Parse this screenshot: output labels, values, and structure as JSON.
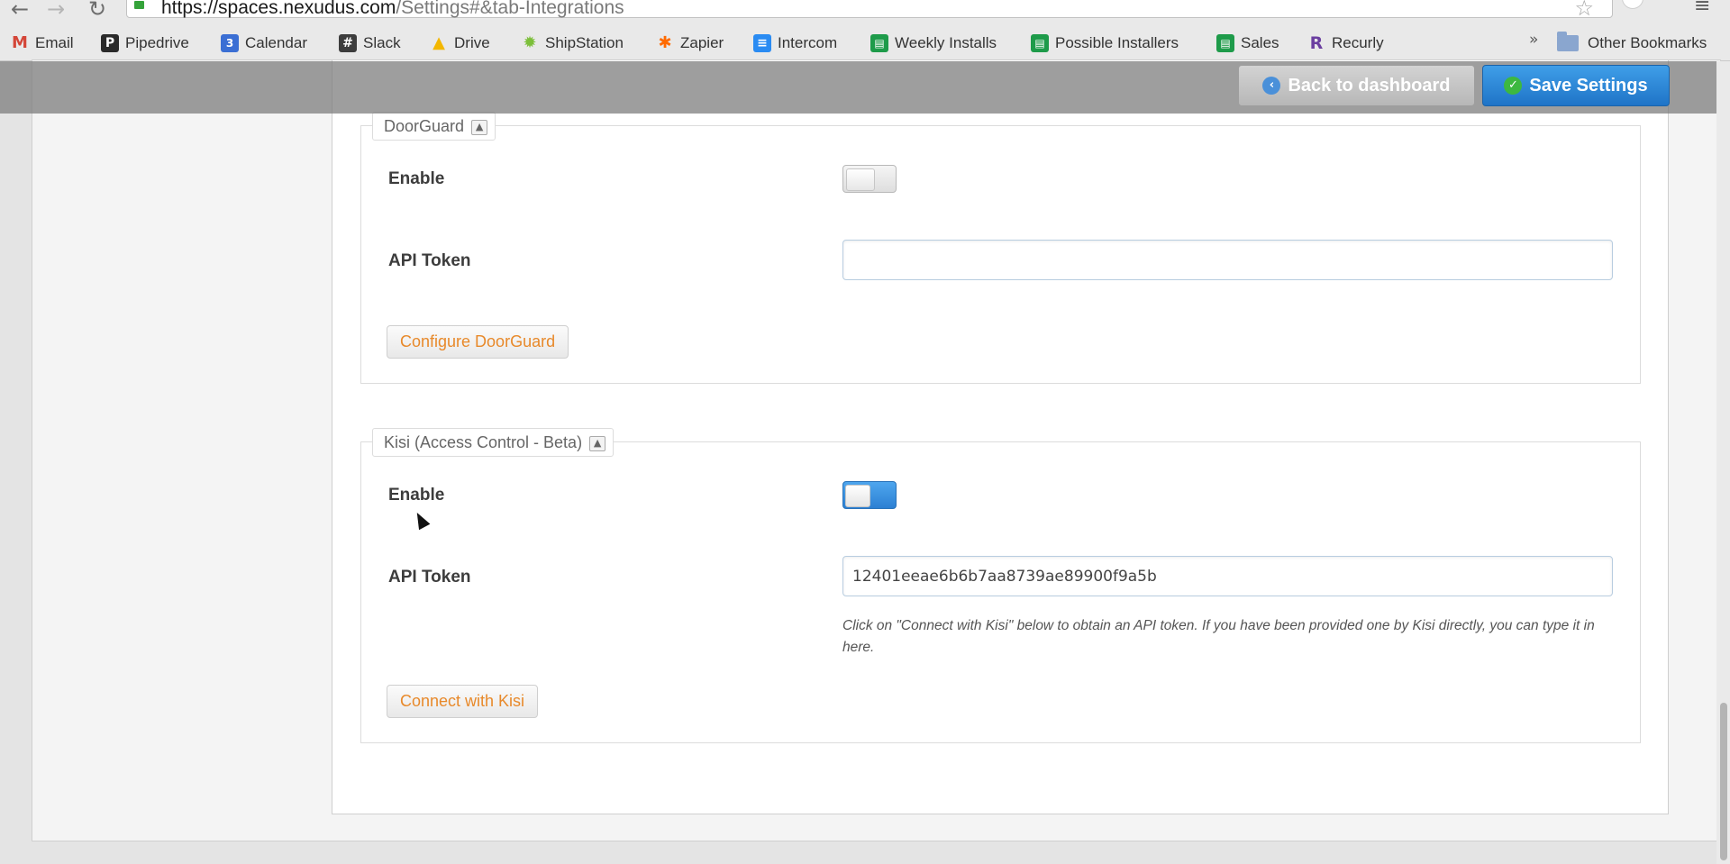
{
  "browser": {
    "url_host": "https://spaces.nexudus.com",
    "url_path": "/Settings#&tab-Integrations",
    "bookmarks": [
      {
        "label": "Email",
        "icon": "gmail-icon",
        "color": "#d44638"
      },
      {
        "label": "Pipedrive",
        "icon": "pipedrive-icon",
        "color": "#2a2a2a"
      },
      {
        "label": "Calendar",
        "icon": "calendar-icon",
        "color": "#3b6fd4"
      },
      {
        "label": "Slack",
        "icon": "slack-icon",
        "color": "#3d3d3d"
      },
      {
        "label": "Drive",
        "icon": "drive-icon",
        "color": "#f3b700"
      },
      {
        "label": "ShipStation",
        "icon": "shipstation-icon",
        "color": "#7cbf3a"
      },
      {
        "label": "Zapier",
        "icon": "zapier-icon",
        "color": "#ff6a00"
      },
      {
        "label": "Intercom",
        "icon": "intercom-icon",
        "color": "#2a8bf2"
      },
      {
        "label": "Weekly Installs",
        "icon": "sheets-icon",
        "color": "#1e9b4a"
      },
      {
        "label": "Possible Installers",
        "icon": "sheets-icon",
        "color": "#1e9b4a"
      },
      {
        "label": "Sales",
        "icon": "sheets-icon",
        "color": "#1e9b4a"
      },
      {
        "label": "Recurly",
        "icon": "recurly-icon",
        "color": "#6b3fa0"
      }
    ],
    "more_chevron": "»",
    "other_bookmarks": "Other Bookmarks"
  },
  "toolbar": {
    "back_label": "Back to dashboard",
    "save_label": "Save Settings"
  },
  "doorguard": {
    "legend": "DoorGuard",
    "enable_label": "Enable",
    "enabled": false,
    "api_token_label": "API Token",
    "api_token_value": "",
    "configure_label": "Configure DoorGuard"
  },
  "kisi": {
    "legend": "Kisi (Access Control - Beta)",
    "enable_label": "Enable",
    "enabled": true,
    "api_token_label": "API Token",
    "api_token_value": "12401eeae6b6b7aa8739ae89900f9a5b",
    "hint": "Click on \"Connect with Kisi\" below to obtain an API token. If you have been provided one by Kisi directly, you can type it in here.",
    "connect_label": "Connect with Kisi"
  },
  "colors": {
    "accent_blue": "#2c80d3",
    "link_orange": "#e8892a"
  }
}
